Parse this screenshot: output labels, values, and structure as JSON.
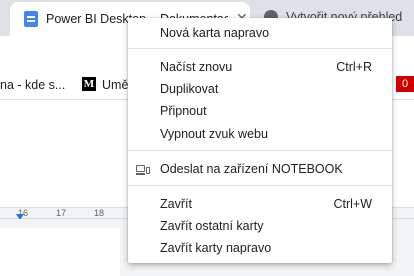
{
  "browser": {
    "active_tab": {
      "title": "Power BI Desktop – Dokumentace Power BI",
      "close_glyph": "✕",
      "icon": "docs-icon"
    },
    "second_tab": {
      "title": "Vytvořit nový přehled",
      "icon": "globe-icon"
    },
    "bookmarks": [
      {
        "label": "na - kde s..."
      },
      {
        "label": "Umě",
        "icon_text": "M"
      },
      {
        "label": "0"
      }
    ],
    "ruler": {
      "ticks": [
        "16",
        "17",
        "18"
      ]
    }
  },
  "context_menu": {
    "items": [
      {
        "label": "Nová karta napravo",
        "shortcut": ""
      },
      {
        "label": "Načíst znovu",
        "shortcut": "Ctrl+R"
      },
      {
        "label": "Duplikovat",
        "shortcut": ""
      },
      {
        "label": "Připnout",
        "shortcut": ""
      },
      {
        "label": "Vypnout zvuk webu",
        "shortcut": ""
      },
      {
        "label": "Odeslat na zařízení NOTEBOOK",
        "shortcut": "",
        "icon": "send-to-device-icon"
      },
      {
        "label": "Zavřít",
        "shortcut": "Ctrl+W"
      },
      {
        "label": "Zavřít ostatní karty",
        "shortcut": ""
      },
      {
        "label": "Zavřít karty napravo",
        "shortcut": ""
      }
    ]
  }
}
